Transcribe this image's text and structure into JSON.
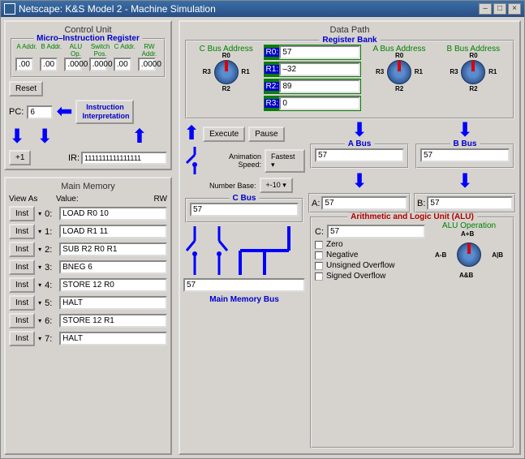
{
  "window_title": "Netscape: K&S Model 2 - Machine Simulation",
  "control_unit": {
    "title": "Control Unit",
    "mir": {
      "legend": "Micro–Instruction Register",
      "cols": [
        {
          "hdr": "A Addr.",
          "val": ".00"
        },
        {
          "hdr": "B Addr.",
          "val": ".00"
        },
        {
          "hdr": "ALU Op.",
          "val": ".0000"
        },
        {
          "hdr": "Switch Pos.",
          "val": ".0000"
        },
        {
          "hdr": "C Addr.",
          "val": ".00"
        },
        {
          "hdr": "RW Addr.",
          "val": ".0000"
        }
      ]
    },
    "reset_label": "Reset",
    "pc_label": "PC:",
    "pc_value": "6",
    "instr_interp_label": "Instruction Interpretation",
    "plus_one_label": "+1",
    "ir_label": "IR:",
    "ir_value": "1111111111111111"
  },
  "main_memory": {
    "title": "Main Memory",
    "view_as": "View As",
    "value_hdr": "Value:",
    "rw_hdr": "RW",
    "inst_label": "Inst",
    "rows": [
      {
        "idx": "0:",
        "val": "LOAD R0 10"
      },
      {
        "idx": "1:",
        "val": "LOAD R1 11"
      },
      {
        "idx": "2:",
        "val": "SUB R2 R0 R1"
      },
      {
        "idx": "3:",
        "val": "BNEG 6"
      },
      {
        "idx": "4:",
        "val": "STORE 12 R0"
      },
      {
        "idx": "5:",
        "val": "HALT"
      },
      {
        "idx": "6:",
        "val": "STORE 12 R1"
      },
      {
        "idx": "7:",
        "val": "HALT"
      }
    ]
  },
  "data_path": {
    "title": "Data Path",
    "reg_bank": {
      "legend": "Register Bank",
      "c_addr": "C Bus Address",
      "a_addr": "A Bus Address",
      "b_addr": "B Bus Address",
      "dial_labels": {
        "r0": "R0",
        "r1": "R1",
        "r2": "R2",
        "r3": "R3"
      },
      "regs": [
        {
          "idx": "R0:",
          "val": "57"
        },
        {
          "idx": "R1:",
          "val": "–32"
        },
        {
          "idx": "R2:",
          "val": "89"
        },
        {
          "idx": "R3:",
          "val": "0"
        }
      ]
    },
    "execute_label": "Execute",
    "pause_label": "Pause",
    "anim_speed_label": "Animation Speed:",
    "anim_speed_val": "Fastest",
    "num_base_label": "Number Base:",
    "num_base_val": "+-10",
    "a_bus": {
      "legend": "A Bus",
      "val": "57"
    },
    "b_bus": {
      "legend": "B Bus",
      "val": "57"
    },
    "c_bus": {
      "legend": "C Bus",
      "val": "57"
    },
    "mm_bus": {
      "legend": "Main Memory Bus",
      "val": "57"
    },
    "ab_a": {
      "label": "A:",
      "val": "57"
    },
    "ab_b": {
      "label": "B:",
      "val": "57"
    },
    "alu": {
      "legend": "Arithmetic and Logic Unit (ALU)",
      "c_label": "C:",
      "c_val": "57",
      "flags": [
        "Zero",
        "Negative",
        "Unsigned Overflow",
        "Signed Overflow"
      ],
      "op_title": "ALU Operation",
      "dial": {
        "top": "A+B",
        "left": "A-B",
        "right": "A|B",
        "bottom": "A&B"
      }
    }
  }
}
